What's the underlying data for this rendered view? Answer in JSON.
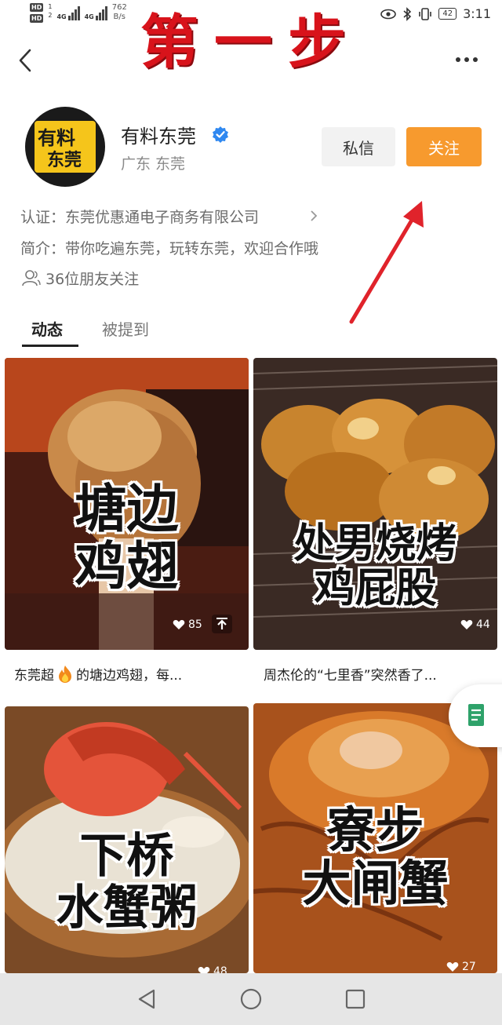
{
  "status_bar": {
    "hd1": "HD",
    "hd2": "HD",
    "sim1": "1",
    "sim2": "2",
    "net1": "4G",
    "net2": "4G",
    "speed": "762",
    "speed_unit": "B/s",
    "battery": "42",
    "time": "3:11"
  },
  "annotation": {
    "step_title": "第一步",
    "color": "#d8131b"
  },
  "profile": {
    "avatar_text_1": "有料",
    "avatar_text_2": "东莞",
    "name": "有料东莞",
    "location": "广东 东莞",
    "message_button": "私信",
    "follow_button": "关注",
    "follow_color": "#f79a2e",
    "cert_label": "认证：",
    "cert_value": "东莞优惠通电子商务有限公司",
    "intro_label": "简介：",
    "intro_value": "带你吃遍东莞，玩转东莞，欢迎合作哦",
    "friends": "36位朋友关注"
  },
  "tabs": [
    {
      "label": "动态",
      "active": true
    },
    {
      "label": "被提到",
      "active": false
    }
  ],
  "posts": [
    {
      "title_line1": "塘边",
      "title_line2": "鸡翅",
      "likes": "85",
      "caption_before": "东莞超",
      "caption_after": "的塘边鸡翅，每...",
      "pinned": true
    },
    {
      "title_line1": "处男烧烤",
      "title_line2": "鸡屁股",
      "likes": "44",
      "caption": "周杰伦的“七里香”突然香了..."
    },
    {
      "title_line1": "下桥",
      "title_line2": "水蟹粥",
      "likes": "48"
    },
    {
      "title_line1": "寮步",
      "title_line2": "大闸蟹",
      "likes": "27"
    }
  ]
}
